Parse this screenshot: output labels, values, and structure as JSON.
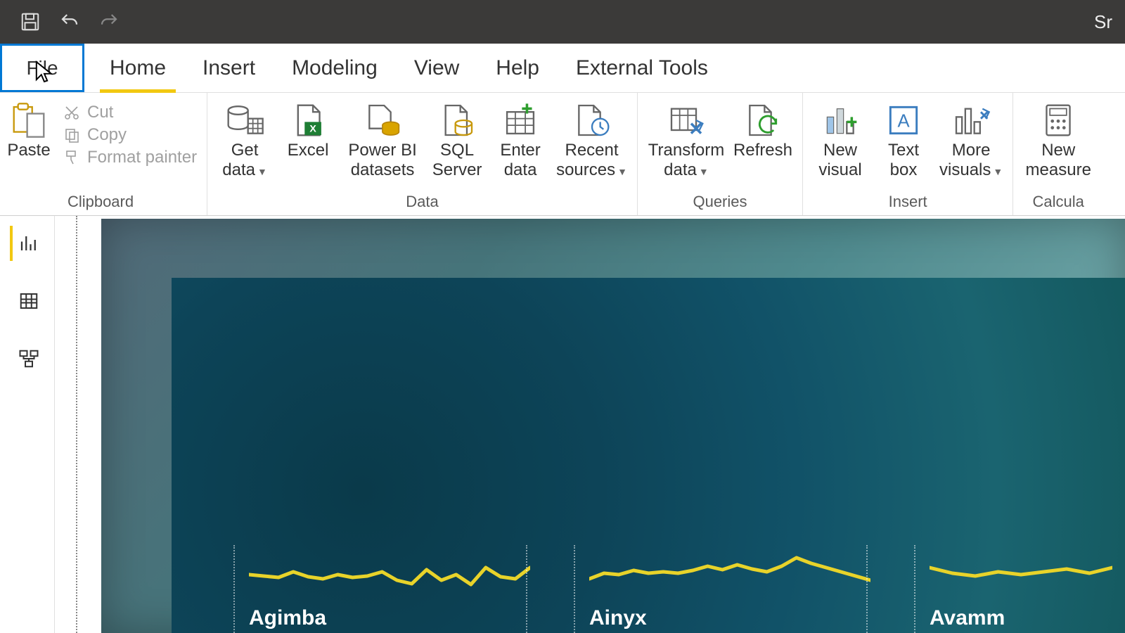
{
  "titlebar": {
    "right_text": "Sr"
  },
  "tabs": {
    "file": "File",
    "items": [
      {
        "label": "Home",
        "active": true
      },
      {
        "label": "Insert"
      },
      {
        "label": "Modeling"
      },
      {
        "label": "View"
      },
      {
        "label": "Help"
      },
      {
        "label": "External Tools"
      }
    ]
  },
  "ribbon": {
    "clipboard": {
      "group": "Clipboard",
      "paste": "Paste",
      "cut": "Cut",
      "copy": "Copy",
      "format_painter": "Format painter"
    },
    "data": {
      "group": "Data",
      "get_data": "Get\ndata",
      "excel": "Excel",
      "pbi_datasets": "Power BI\ndatasets",
      "sql_server": "SQL\nServer",
      "enter_data": "Enter\ndata",
      "recent_sources": "Recent\nsources"
    },
    "queries": {
      "group": "Queries",
      "transform_data": "Transform\ndata",
      "refresh": "Refresh"
    },
    "insert": {
      "group": "Insert",
      "new_visual": "New\nvisual",
      "text_box": "Text\nbox",
      "more_visuals": "More\nvisuals"
    },
    "calc": {
      "group": "Calcula",
      "new_measure": "New\nmeasure"
    }
  },
  "sidebar": {
    "report": "report-view",
    "data": "data-view",
    "model": "model-view"
  },
  "chart_data": {
    "type": "line",
    "color": "#e8d32a",
    "series": [
      {
        "name": "Agimba",
        "values": [
          48,
          46,
          44,
          52,
          45,
          42,
          48,
          44,
          46,
          52,
          40,
          35,
          55,
          40,
          48,
          34,
          58,
          45,
          42,
          58
        ]
      },
      {
        "name": "Ainyx",
        "values": [
          42,
          50,
          48,
          54,
          50,
          52,
          50,
          54,
          60,
          55,
          62,
          56,
          52,
          60,
          72,
          64,
          58,
          52,
          46,
          40
        ]
      },
      {
        "name": "Avamm",
        "values": [
          58,
          50,
          46,
          52,
          48,
          52,
          56,
          50,
          58
        ]
      }
    ]
  }
}
